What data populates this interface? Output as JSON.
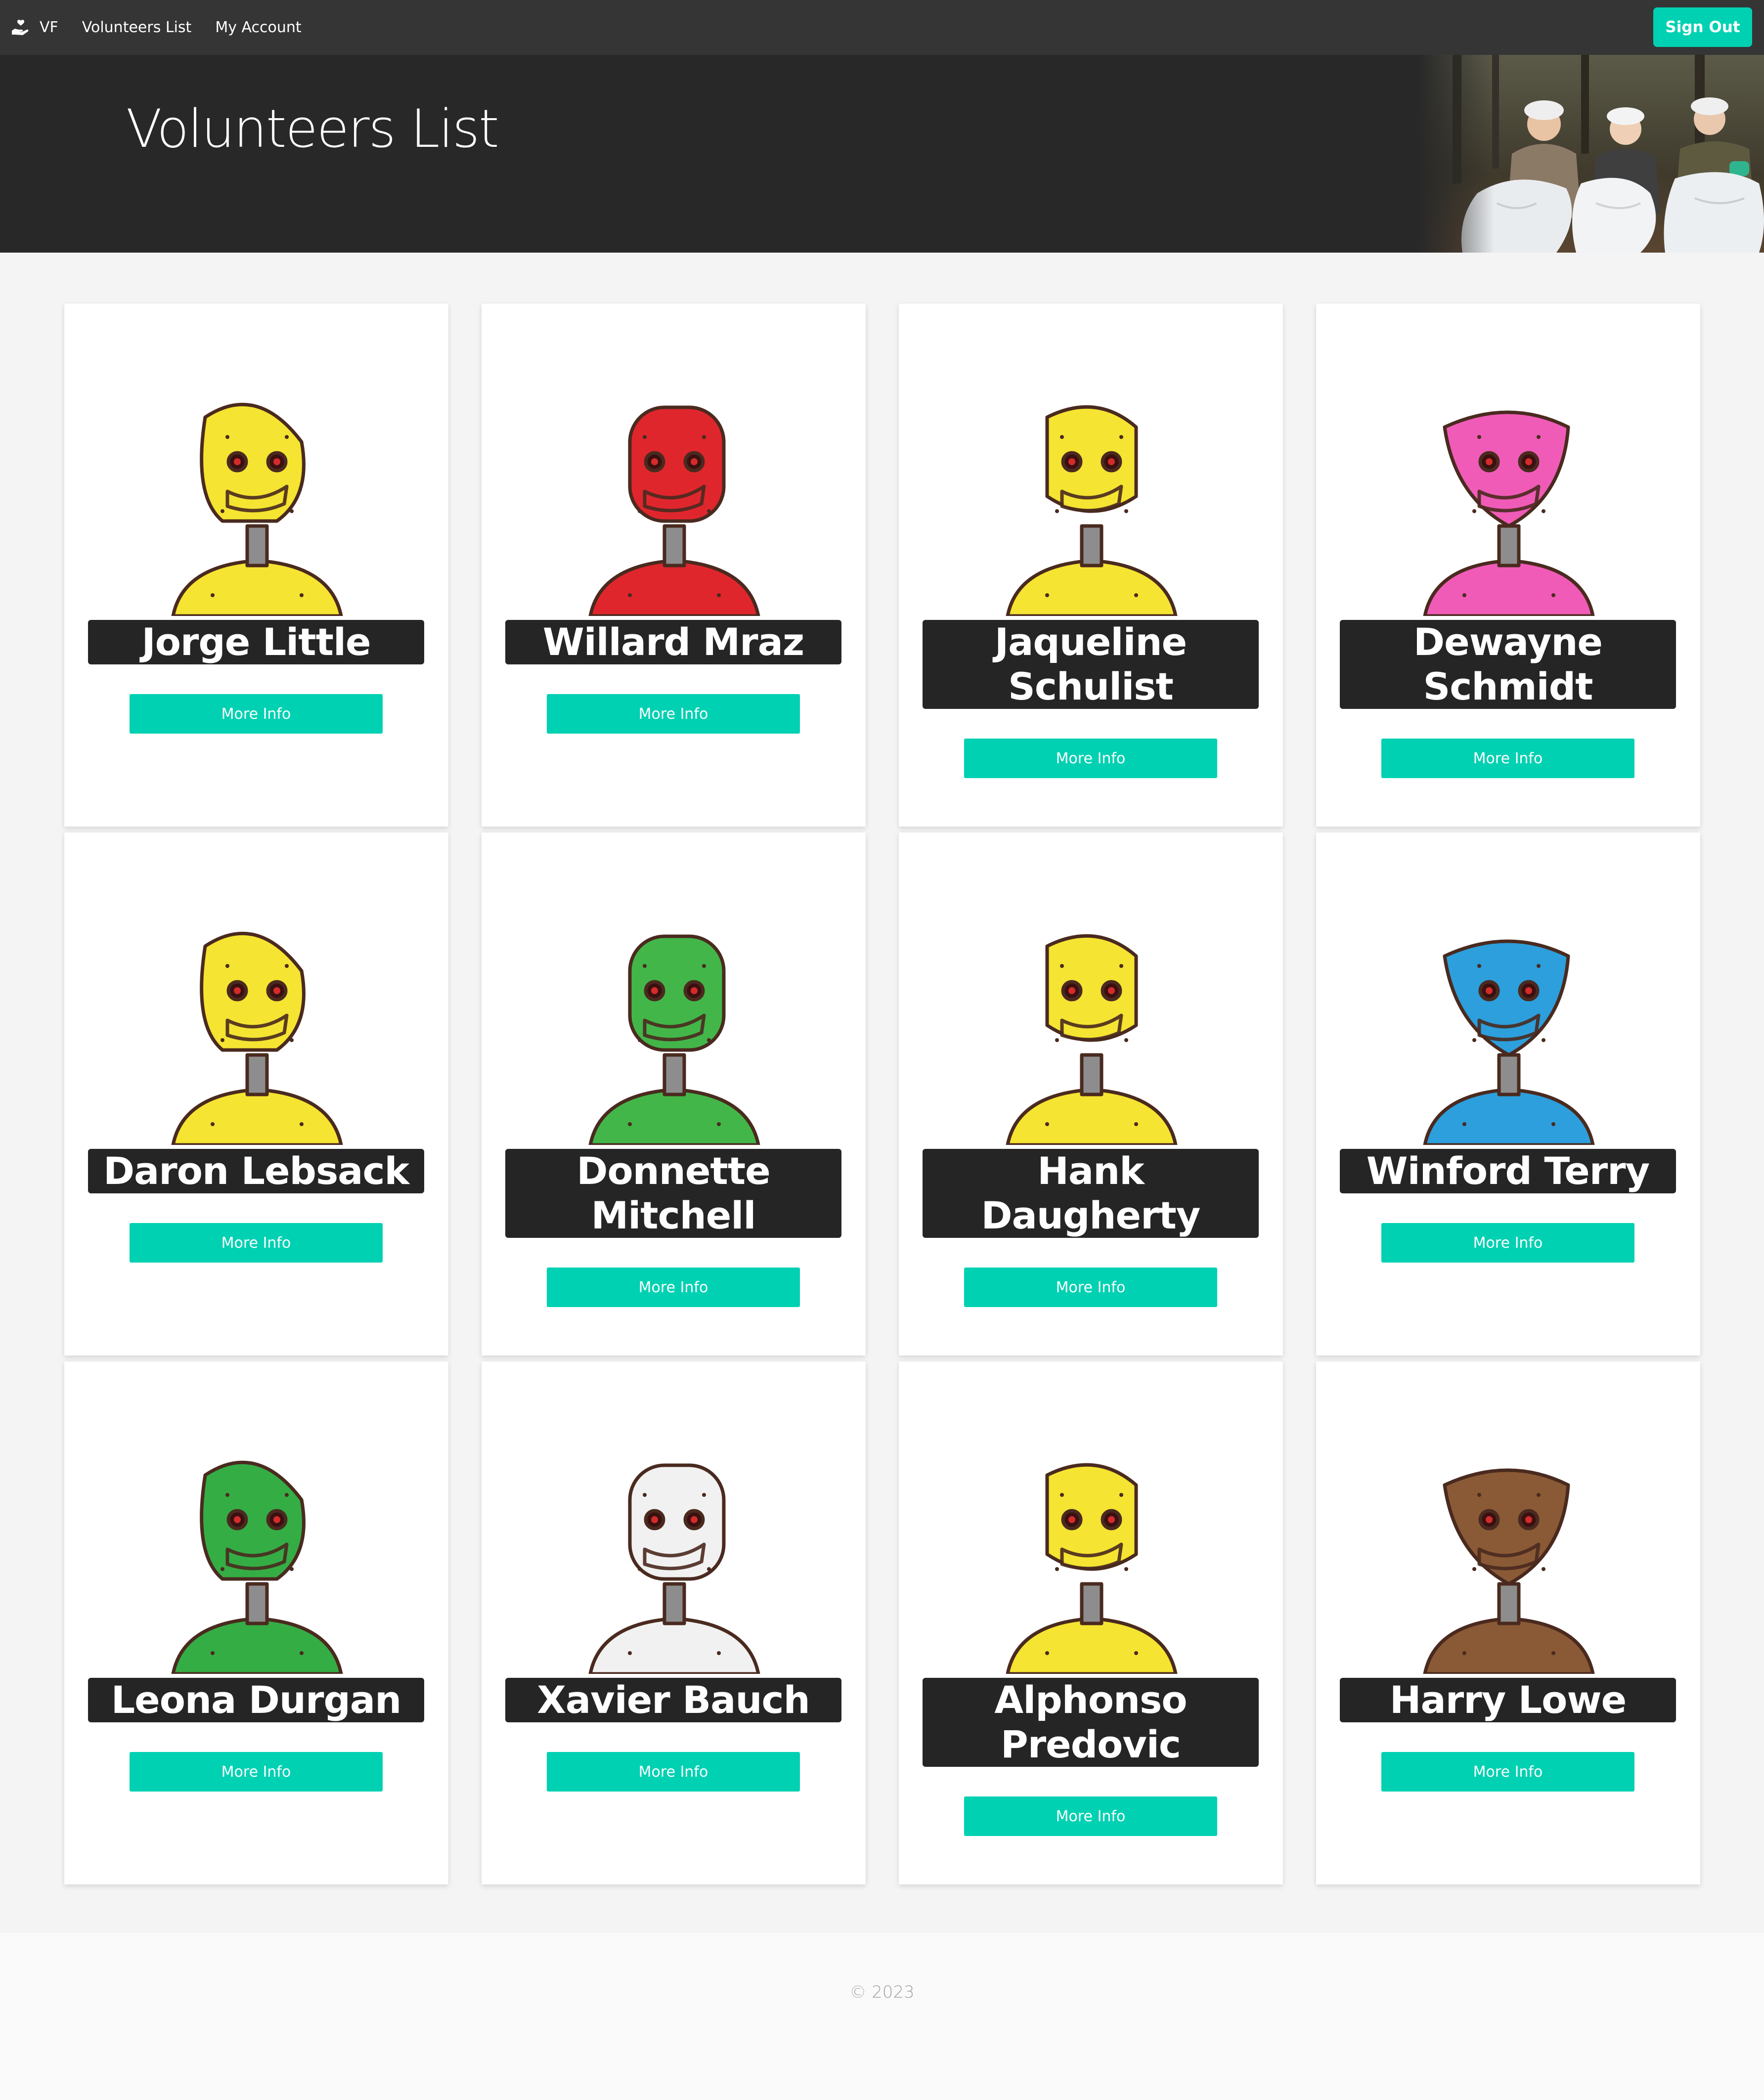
{
  "navbar": {
    "brand": "VF",
    "links": [
      "Volunteers List",
      "My Account"
    ],
    "sign_out": "Sign Out",
    "brand_icon": "hand-holding-heart-icon"
  },
  "hero": {
    "title": "Volunteers List",
    "photo": "volunteers-collecting-trash-photo"
  },
  "volunteers": [
    {
      "name": "Jorge Little",
      "button": "More Info",
      "robot_color": "#f5e431"
    },
    {
      "name": "Willard Mraz",
      "button": "More Info",
      "robot_color": "#e0262d"
    },
    {
      "name": "Jaqueline Schulist",
      "button": "More Info",
      "robot_color": "#f5e431"
    },
    {
      "name": "Dewayne Schmidt",
      "button": "More Info",
      "robot_color": "#f05bb8"
    },
    {
      "name": "Daron Lebsack",
      "button": "More Info",
      "robot_color": "#f5e431"
    },
    {
      "name": "Donnette Mitchell",
      "button": "More Info",
      "robot_color": "#43b649"
    },
    {
      "name": "Hank Daugherty",
      "button": "More Info",
      "robot_color": "#f5e431"
    },
    {
      "name": "Winford Terry",
      "button": "More Info",
      "robot_color": "#2c9fdc"
    },
    {
      "name": "Leona Durgan",
      "button": "More Info",
      "robot_color": "#35ad45"
    },
    {
      "name": "Xavier Bauch",
      "button": "More Info",
      "robot_color": "#f1f1f1"
    },
    {
      "name": "Alphonso Predovic",
      "button": "More Info",
      "robot_color": "#f5e431"
    },
    {
      "name": "Harry Lowe",
      "button": "More Info",
      "robot_color": "#8a5a36"
    }
  ],
  "footer": {
    "copyright": "© 2023"
  },
  "colors": {
    "accent": "#00d1b2",
    "navbar": "#353535",
    "hero": "#282828"
  }
}
